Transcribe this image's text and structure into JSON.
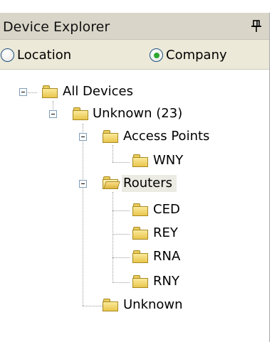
{
  "panel": {
    "title": "Device Explorer",
    "pin_icon": "pushpin-icon"
  },
  "grouping": {
    "options": [
      {
        "label": "Location",
        "selected": false
      },
      {
        "label": "Company",
        "selected": true
      }
    ]
  },
  "tree": {
    "nodes": [
      {
        "label": "All Devices",
        "level": 0,
        "expanded": true
      },
      {
        "label": "Unknown (23)",
        "level": 1,
        "expanded": true
      },
      {
        "label": "Access Points",
        "level": 2,
        "expanded": true
      },
      {
        "label": "WNY",
        "level": 3
      },
      {
        "label": "Routers",
        "level": 2,
        "expanded": true,
        "selected": true
      },
      {
        "label": "CED",
        "level": 3
      },
      {
        "label": "REY",
        "level": 3
      },
      {
        "label": "RNA",
        "level": 3
      },
      {
        "label": "RNY",
        "level": 3
      },
      {
        "label": "Unknown",
        "level": 2
      }
    ]
  }
}
